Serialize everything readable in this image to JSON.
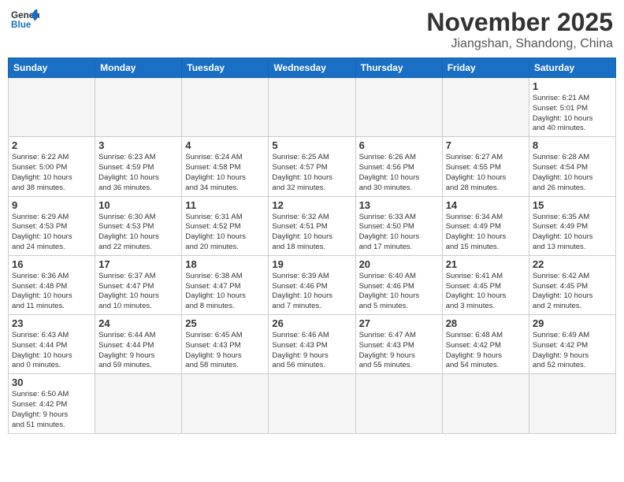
{
  "header": {
    "logo_general": "General",
    "logo_blue": "Blue",
    "month_title": "November 2025",
    "location": "Jiangshan, Shandong, China"
  },
  "weekdays": [
    "Sunday",
    "Monday",
    "Tuesday",
    "Wednesday",
    "Thursday",
    "Friday",
    "Saturday"
  ],
  "weeks": [
    [
      {
        "day": "",
        "info": ""
      },
      {
        "day": "",
        "info": ""
      },
      {
        "day": "",
        "info": ""
      },
      {
        "day": "",
        "info": ""
      },
      {
        "day": "",
        "info": ""
      },
      {
        "day": "",
        "info": ""
      },
      {
        "day": "1",
        "info": "Sunrise: 6:21 AM\nSunset: 5:01 PM\nDaylight: 10 hours\nand 40 minutes."
      }
    ],
    [
      {
        "day": "2",
        "info": "Sunrise: 6:22 AM\nSunset: 5:00 PM\nDaylight: 10 hours\nand 38 minutes."
      },
      {
        "day": "3",
        "info": "Sunrise: 6:23 AM\nSunset: 4:59 PM\nDaylight: 10 hours\nand 36 minutes."
      },
      {
        "day": "4",
        "info": "Sunrise: 6:24 AM\nSunset: 4:58 PM\nDaylight: 10 hours\nand 34 minutes."
      },
      {
        "day": "5",
        "info": "Sunrise: 6:25 AM\nSunset: 4:57 PM\nDaylight: 10 hours\nand 32 minutes."
      },
      {
        "day": "6",
        "info": "Sunrise: 6:26 AM\nSunset: 4:56 PM\nDaylight: 10 hours\nand 30 minutes."
      },
      {
        "day": "7",
        "info": "Sunrise: 6:27 AM\nSunset: 4:55 PM\nDaylight: 10 hours\nand 28 minutes."
      },
      {
        "day": "8",
        "info": "Sunrise: 6:28 AM\nSunset: 4:54 PM\nDaylight: 10 hours\nand 26 minutes."
      }
    ],
    [
      {
        "day": "9",
        "info": "Sunrise: 6:29 AM\nSunset: 4:53 PM\nDaylight: 10 hours\nand 24 minutes."
      },
      {
        "day": "10",
        "info": "Sunrise: 6:30 AM\nSunset: 4:53 PM\nDaylight: 10 hours\nand 22 minutes."
      },
      {
        "day": "11",
        "info": "Sunrise: 6:31 AM\nSunset: 4:52 PM\nDaylight: 10 hours\nand 20 minutes."
      },
      {
        "day": "12",
        "info": "Sunrise: 6:32 AM\nSunset: 4:51 PM\nDaylight: 10 hours\nand 18 minutes."
      },
      {
        "day": "13",
        "info": "Sunrise: 6:33 AM\nSunset: 4:50 PM\nDaylight: 10 hours\nand 17 minutes."
      },
      {
        "day": "14",
        "info": "Sunrise: 6:34 AM\nSunset: 4:49 PM\nDaylight: 10 hours\nand 15 minutes."
      },
      {
        "day": "15",
        "info": "Sunrise: 6:35 AM\nSunset: 4:49 PM\nDaylight: 10 hours\nand 13 minutes."
      }
    ],
    [
      {
        "day": "16",
        "info": "Sunrise: 6:36 AM\nSunset: 4:48 PM\nDaylight: 10 hours\nand 11 minutes."
      },
      {
        "day": "17",
        "info": "Sunrise: 6:37 AM\nSunset: 4:47 PM\nDaylight: 10 hours\nand 10 minutes."
      },
      {
        "day": "18",
        "info": "Sunrise: 6:38 AM\nSunset: 4:47 PM\nDaylight: 10 hours\nand 8 minutes."
      },
      {
        "day": "19",
        "info": "Sunrise: 6:39 AM\nSunset: 4:46 PM\nDaylight: 10 hours\nand 7 minutes."
      },
      {
        "day": "20",
        "info": "Sunrise: 6:40 AM\nSunset: 4:46 PM\nDaylight: 10 hours\nand 5 minutes."
      },
      {
        "day": "21",
        "info": "Sunrise: 6:41 AM\nSunset: 4:45 PM\nDaylight: 10 hours\nand 3 minutes."
      },
      {
        "day": "22",
        "info": "Sunrise: 6:42 AM\nSunset: 4:45 PM\nDaylight: 10 hours\nand 2 minutes."
      }
    ],
    [
      {
        "day": "23",
        "info": "Sunrise: 6:43 AM\nSunset: 4:44 PM\nDaylight: 10 hours\nand 0 minutes."
      },
      {
        "day": "24",
        "info": "Sunrise: 6:44 AM\nSunset: 4:44 PM\nDaylight: 9 hours\nand 59 minutes."
      },
      {
        "day": "25",
        "info": "Sunrise: 6:45 AM\nSunset: 4:43 PM\nDaylight: 9 hours\nand 58 minutes."
      },
      {
        "day": "26",
        "info": "Sunrise: 6:46 AM\nSunset: 4:43 PM\nDaylight: 9 hours\nand 56 minutes."
      },
      {
        "day": "27",
        "info": "Sunrise: 6:47 AM\nSunset: 4:43 PM\nDaylight: 9 hours\nand 55 minutes."
      },
      {
        "day": "28",
        "info": "Sunrise: 6:48 AM\nSunset: 4:42 PM\nDaylight: 9 hours\nand 54 minutes."
      },
      {
        "day": "29",
        "info": "Sunrise: 6:49 AM\nSunset: 4:42 PM\nDaylight: 9 hours\nand 52 minutes."
      }
    ],
    [
      {
        "day": "30",
        "info": "Sunrise: 6:50 AM\nSunset: 4:42 PM\nDaylight: 9 hours\nand 51 minutes."
      },
      {
        "day": "",
        "info": ""
      },
      {
        "day": "",
        "info": ""
      },
      {
        "day": "",
        "info": ""
      },
      {
        "day": "",
        "info": ""
      },
      {
        "day": "",
        "info": ""
      },
      {
        "day": "",
        "info": ""
      }
    ]
  ]
}
